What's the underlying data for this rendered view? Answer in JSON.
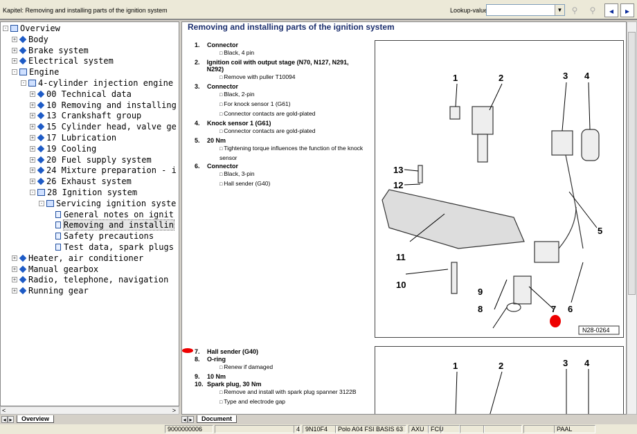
{
  "window": {
    "title": "Kapitel: Removing and installing parts of the ignition system",
    "lookup_label": "Lookup-value:",
    "lookup_value": ""
  },
  "tree": [
    {
      "label": "Overview",
      "level": 0,
      "icon": "open-book",
      "exp": "-"
    },
    {
      "label": "Body",
      "level": 1,
      "icon": "book",
      "exp": "+"
    },
    {
      "label": "Brake system",
      "level": 1,
      "icon": "book",
      "exp": "+"
    },
    {
      "label": "Electrical system",
      "level": 1,
      "icon": "book",
      "exp": "+"
    },
    {
      "label": "Engine",
      "level": 1,
      "icon": "open-book",
      "exp": "-"
    },
    {
      "label": "4-cylinder injection engine",
      "level": 2,
      "icon": "open-book",
      "exp": "-"
    },
    {
      "label": "00 Technical data",
      "level": 3,
      "icon": "book",
      "exp": "+"
    },
    {
      "label": "10 Removing and installing",
      "level": 3,
      "icon": "book",
      "exp": "+"
    },
    {
      "label": "13 Crankshaft group",
      "level": 3,
      "icon": "book",
      "exp": "+"
    },
    {
      "label": "15 Cylinder head, valve ge",
      "level": 3,
      "icon": "book",
      "exp": "+"
    },
    {
      "label": "17 Lubrication",
      "level": 3,
      "icon": "book",
      "exp": "+"
    },
    {
      "label": "19 Cooling",
      "level": 3,
      "icon": "book",
      "exp": "+"
    },
    {
      "label": "20 Fuel supply system",
      "level": 3,
      "icon": "book",
      "exp": "+"
    },
    {
      "label": "24 Mixture preparation - i",
      "level": 3,
      "icon": "book",
      "exp": "+"
    },
    {
      "label": "26 Exhaust system",
      "level": 3,
      "icon": "book",
      "exp": "+"
    },
    {
      "label": "28 Ignition system",
      "level": 3,
      "icon": "open-book",
      "exp": "-"
    },
    {
      "label": "Servicing ignition syste",
      "level": 4,
      "icon": "open-book",
      "exp": "-"
    },
    {
      "label": "General notes on ignit",
      "level": 5,
      "icon": "doc",
      "exp": ""
    },
    {
      "label": "Removing and installin",
      "level": 5,
      "icon": "doc",
      "exp": "",
      "selected": true
    },
    {
      "label": "Safety precautions",
      "level": 5,
      "icon": "doc",
      "exp": ""
    },
    {
      "label": "Test data, spark plugs",
      "level": 5,
      "icon": "doc",
      "exp": ""
    },
    {
      "label": "Heater, air conditioner",
      "level": 1,
      "icon": "book",
      "exp": "+"
    },
    {
      "label": "Manual gearbox",
      "level": 1,
      "icon": "book",
      "exp": "+"
    },
    {
      "label": "Radio, telephone, navigation",
      "level": 1,
      "icon": "book",
      "exp": "+"
    },
    {
      "label": "Running gear",
      "level": 1,
      "icon": "book",
      "exp": "+"
    }
  ],
  "tabs": {
    "left": "Overview",
    "right": "Document"
  },
  "doc": {
    "heading": "Removing and installing parts of the ignition system",
    "items1": [
      {
        "n": "1.",
        "title": "Connector",
        "subs": [
          "Black, 4 pin"
        ]
      },
      {
        "n": "2.",
        "title": "Ignition coil with output stage (N70, N127, N291, N292)",
        "subs": [
          "Remove with puller T10094"
        ]
      },
      {
        "n": "3.",
        "title": "Connector",
        "subs": [
          "Black, 2-pin",
          "For knock sensor 1 (G61)",
          "Connector contacts are gold-plated"
        ]
      },
      {
        "n": "4.",
        "title": "Knock sensor 1 (G61)",
        "subs": [
          "Connector contacts are gold-plated"
        ]
      },
      {
        "n": "5.",
        "title": "20 Nm",
        "subs": [
          "Tightening torque influences the function of the knock sensor"
        ]
      },
      {
        "n": "6.",
        "title": "Connector",
        "subs": [
          "Black, 3-pin",
          "Hall sender (G40)"
        ]
      }
    ],
    "items2": [
      {
        "n": "7.",
        "title": "Hall sender (G40)",
        "subs": []
      },
      {
        "n": "8.",
        "title": "O-ring",
        "subs": [
          "Renew if damaged"
        ]
      },
      {
        "n": "9.",
        "title": "10 Nm",
        "subs": []
      },
      {
        "n": "10.",
        "title": "Spark plug, 30 Nm",
        "subs": [
          "Remove and install with spark plug spanner 3122B",
          "Type and electrode gap"
        ]
      }
    ],
    "figure_id": "N28-0264",
    "callouts": [
      "1",
      "2",
      "3",
      "4",
      "5",
      "6",
      "7",
      "8",
      "9",
      "10",
      "11",
      "12",
      "13"
    ],
    "callouts2": [
      "1",
      "2",
      "3",
      "4"
    ]
  },
  "status": [
    "9000000006",
    "",
    "4",
    "9N10F4",
    "Polo A04 FSI BASIS 63",
    "AXU",
    "FCU",
    "",
    "",
    "",
    "",
    "PAAL"
  ]
}
